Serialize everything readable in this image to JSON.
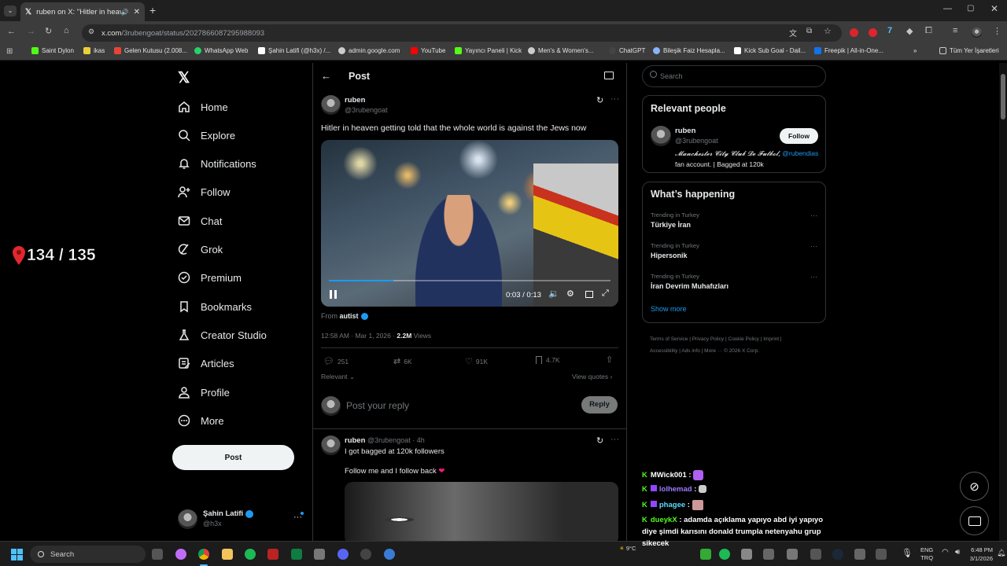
{
  "browser": {
    "tab_title": "ruben on X: \"Hitler in heave",
    "url_host": "x.com",
    "url_path": "/3rubengoat/status/2027866087295988093",
    "bookmarks": [
      "Saint Dylon",
      "ikas",
      "Gelen Kutusu (2.008...",
      "WhatsApp Web",
      "Şahin Latifi (@h3x) /...",
      "admin.google.com",
      "YouTube",
      "Yayıncı Paneli | Kick",
      "Men's & Women's...",
      "ChatGPT",
      "Bileşik Faiz Hesapla...",
      "Kick Sub Goal - Dail...",
      "Freepik | All-in-One..."
    ],
    "all_bookmarks": "Tüm Yer İşaretleri"
  },
  "overlay": {
    "counter": "134 / 135"
  },
  "nav": {
    "items": [
      "Home",
      "Explore",
      "Notifications",
      "Follow",
      "Chat",
      "Grok",
      "Premium",
      "Bookmarks",
      "Creator Studio",
      "Articles",
      "Profile",
      "More"
    ],
    "post_button": "Post",
    "account_name": "Şahin Latifi",
    "account_handle": "@h3x"
  },
  "header": {
    "title": "Post"
  },
  "tweet": {
    "author": "ruben",
    "handle": "@3rubengoat",
    "text": "Hitler in heaven getting told that the whole world is against the Jews now",
    "video_time": "0:03 / 0:13",
    "video_progress": 0.23,
    "from_label": "From",
    "from_account": "autist",
    "timestamp": "12:58 AM · Mar 1, 2026 · ",
    "views_count": "2.2M",
    "views_label": " Views",
    "replies": "251",
    "reposts": "6K",
    "likes": "91K",
    "bookmarks": "4.7K",
    "sort_label": "Relevant",
    "view_quotes": "View quotes",
    "reply_placeholder": "Post your reply",
    "reply_button": "Reply"
  },
  "reply_tweet": {
    "author": "ruben",
    "meta": "@3rubengoat · 4h",
    "line1": "I got bagged at 120k followers",
    "line2": "Follow me and I follow back"
  },
  "search": {
    "placeholder": "Search"
  },
  "relevant": {
    "title": "Relevant people",
    "name": "ruben",
    "handle": "@3rubengoat",
    "follow": "Follow",
    "bio_styled": "𝓜𝓪𝓷𝓬𝓱𝓮𝓼𝓽𝓮𝓻 𝓒𝓲𝓽𝔂 𝓒𝓵𝓾𝓫 𝓓𝓮 𝓕𝓾𝓽𝓫𝓸𝓵,",
    "bio_mention": "@rubendias",
    "bio_rest": " fan account. | Bagged at 120k"
  },
  "happening": {
    "title": "What’s happening",
    "trends": [
      {
        "context": "Trending in Turkey",
        "name": "Türkiye İran"
      },
      {
        "context": "Trending in Turkey",
        "name": "Hipersonik"
      },
      {
        "context": "Trending in Turkey",
        "name": "İran Devrim Muhafızları"
      }
    ],
    "show_more": "Show more"
  },
  "footer": {
    "links": [
      "Terms of Service",
      "Privacy Policy",
      "Cookie Policy",
      "Imprint",
      "Accessibility",
      "Ads info",
      "More ···",
      "© 2026 X Corp."
    ]
  },
  "chat": {
    "messages": [
      {
        "user": "MWick001",
        "text": ":",
        "color": "#ffffff"
      },
      {
        "user": "lolhemad",
        "text": ":",
        "color": "#9147ff"
      },
      {
        "user": "phagee",
        "text": ":",
        "color": "#5ddcff"
      },
      {
        "user": "dueykX",
        "text": ": adamda açıklama yapıyo abd iyi yapıyo",
        "color": "#ffffff"
      }
    ],
    "wrap": "diye şimdi karısını donald trumpla netenyahu grup",
    "wrap2": "sikecek"
  },
  "taskbar": {
    "search": "Search",
    "weather": "9°C",
    "lang1": "ENG",
    "lang2": "TRQ",
    "time": "6:48 PM",
    "date": "3/1/2026"
  },
  "colors": {
    "accent": "#1d9bf0",
    "kick": "#53fc18",
    "heart": "#f91880"
  }
}
